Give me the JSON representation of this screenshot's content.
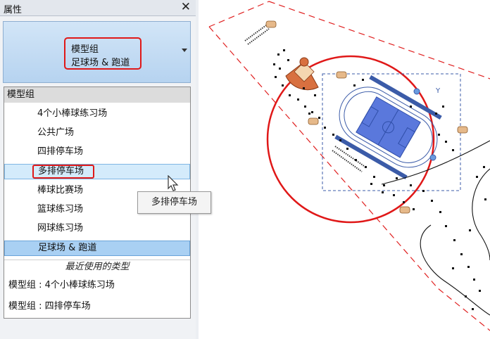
{
  "palette": {
    "title": "属性",
    "close_symbol": "✕",
    "type_selector": {
      "family": "模型组",
      "type": "足球场 & 跑道"
    }
  },
  "dropdown": {
    "header": "模型组",
    "items": [
      {
        "label": "4个小棒球练习场",
        "state": "normal"
      },
      {
        "label": "公共广场",
        "state": "normal"
      },
      {
        "label": "四排停车场",
        "state": "normal"
      },
      {
        "label": "多排停车场",
        "state": "hover"
      },
      {
        "label": "棒球比赛场",
        "state": "normal"
      },
      {
        "label": "篮球练习场",
        "state": "normal"
      },
      {
        "label": "网球练习场",
        "state": "normal"
      },
      {
        "label": "足球场 & 跑道",
        "state": "selected"
      }
    ],
    "recent_header": "最近使用的类型",
    "recent_items": [
      "模型组 : 4个小棒球练习场",
      "模型组 : 四排停车场"
    ]
  },
  "tooltip": "多排停车场",
  "plan_view": {
    "axis_label": "Y"
  },
  "colors": {
    "highlight_red": "#e01818",
    "selection_blue": "#a9d0f3",
    "field_blue": "#4a6fd6",
    "boundary_dash": "#e02020"
  }
}
